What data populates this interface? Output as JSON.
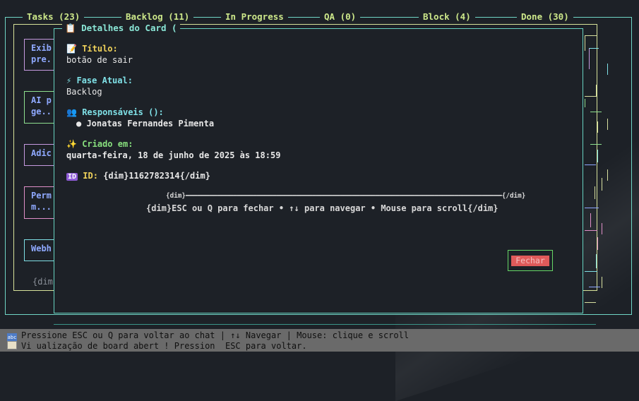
{
  "tabs": [
    {
      "label": "Tasks (23)"
    },
    {
      "label": "Backlog (11)"
    },
    {
      "label": "In Progress"
    },
    {
      "label": "QA (0)"
    },
    {
      "label": "Block (4)"
    },
    {
      "label": "Done (30)"
    }
  ],
  "cards": [
    {
      "line1": "Exib",
      "line2": "pre."
    },
    {
      "line1": "AI p",
      "line2": "ge.."
    },
    {
      "line1": "Adic",
      "line2": ""
    },
    {
      "line1": "Perm",
      "line2": "m..."
    },
    {
      "line1": "Webh",
      "line2": ""
    }
  ],
  "left_dim": "{dim",
  "modal": {
    "title": "Detalhes do Card (",
    "title_icon": "clipboard-icon",
    "fields": {
      "titulo_label": "Título:",
      "titulo_value": "botão de sair",
      "fase_label": "Fase Atual:",
      "fase_value": "Backlog",
      "resp_label": "Responsáveis ():",
      "resp_value": "● Jonatas Fernandes Pimenta",
      "criado_label": "Criado em:",
      "criado_value": "quarta-feira, 18 de junho de 2025 às 18:59",
      "id_label": "ID:",
      "id_value": "{dim}1162782314{/dim}"
    },
    "divider": "{dim}━━━━━━━━━━━━━━━━━━━━━━━━━━━━━━━━━━━━━━━━━━━━━━━━━━━━━━━━━━━━━━━━━━━━━━━━━━━━━━━━{/dim}",
    "hint": "{dim}ESC ou Q para fechar • ↑↓ para navegar • Mouse para scroll{/dim}",
    "close_label": "Fechar"
  },
  "status": {
    "line1": "Pressione ESC ou Q para voltar ao chat | ↑↓ Navegar | Mouse: clique e scroll",
    "line2": "Vi ualização de board abert ! Pression  ESC para voltar."
  },
  "colors": {
    "accent": "#67d2c0",
    "close": "#e05a5a",
    "card_text": "#8fa9ff",
    "tab_text": "#cde88a"
  }
}
